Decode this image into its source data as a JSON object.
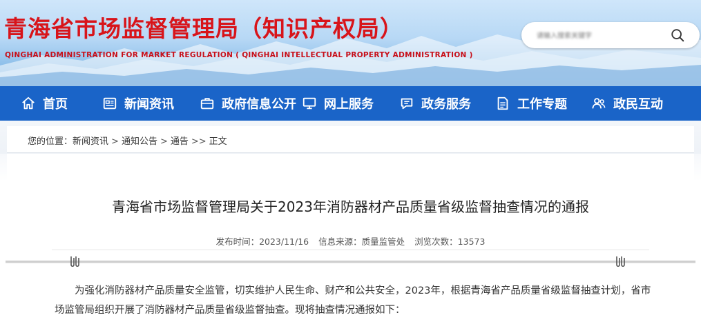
{
  "header": {
    "title": "青海省市场监督管理局（知识产权局）",
    "subtitle": "QINGHAI ADMINISTRATION FOR MARKET REGULATION ( QINGHAI INTELLECTUAL PROPERTY ADMINISTRATION )",
    "search_placeholder": "请输入搜索关键字",
    "search_icon": "search-icon"
  },
  "nav": {
    "items": [
      {
        "label": "首页",
        "icon": "home-icon"
      },
      {
        "label": "新闻资讯",
        "icon": "news-icon"
      },
      {
        "label": "政府信息公开",
        "icon": "briefcase-icon"
      },
      {
        "label": "网上服务",
        "icon": "monitor-icon"
      },
      {
        "label": "政务服务",
        "icon": "chat-icon"
      },
      {
        "label": "工作专题",
        "icon": "document-icon"
      },
      {
        "label": "政民互动",
        "icon": "people-icon"
      }
    ]
  },
  "breadcrumb": {
    "prefix": "您的位置：",
    "items": [
      "新闻资讯",
      "通知公告",
      "通告"
    ],
    "sep": ">",
    "last_sep": ">>",
    "current": "正文"
  },
  "article": {
    "title": "青海省市场监督管理局关于2023年消防器材产品质量省级监督抽查情况的通报",
    "meta": {
      "date_label": "发布时间：",
      "date": "2023/11/16",
      "source_label": "信息来源：",
      "source": "质量监管处",
      "views_label": "浏览次数：",
      "views": "13573"
    },
    "body": "为强化消防器材产品质量安全监管，切实维护人民生命、财产和公共安全，2023年，根据青海省产品质量省级监督抽查计划，省市场监管局组织开展了消防器材产品质量省级监督抽查。现将抽查情况通报如下："
  },
  "colors": {
    "title_red": "#d8141a",
    "nav_blue": "#1a64c8",
    "sky_top": "#cfe6fa",
    "sky_bottom": "#6aa9df"
  }
}
